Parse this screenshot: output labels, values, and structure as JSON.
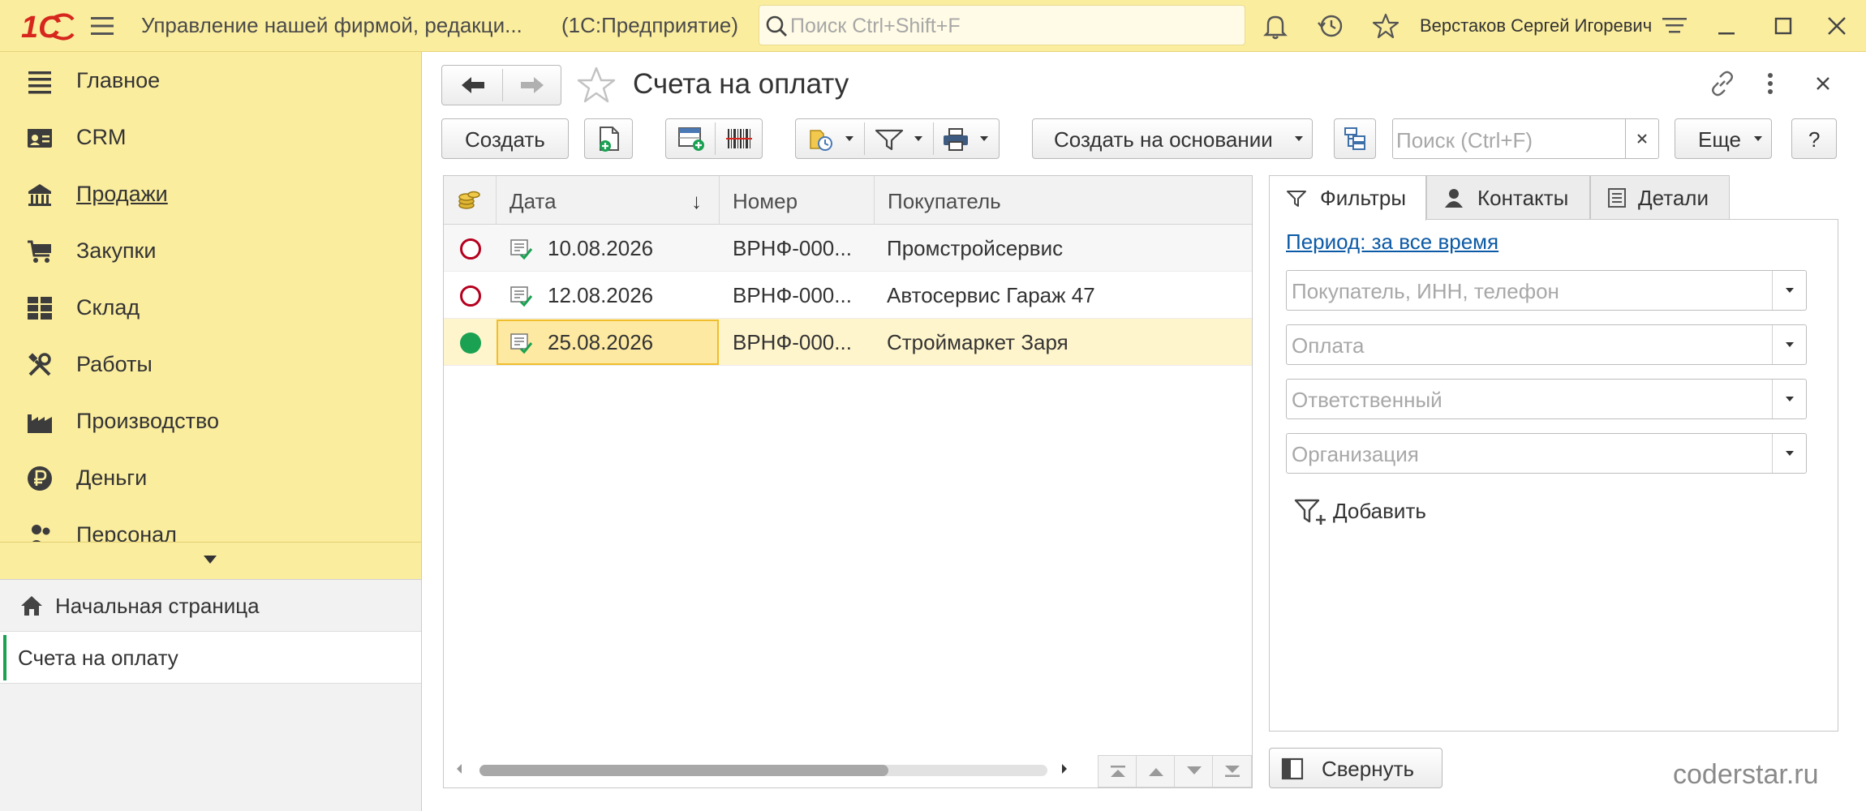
{
  "app": {
    "logo": "1С",
    "title": "Управление нашей фирмой, редакци...",
    "platform": "(1С:Предприятие)",
    "search_placeholder": "Поиск Ctrl+Shift+F",
    "user": "Верстаков Сергей Игоревич"
  },
  "sidebar": {
    "items": [
      {
        "label": "Главное",
        "icon": "list-icon"
      },
      {
        "label": "CRM",
        "icon": "contact-card-icon"
      },
      {
        "label": "Продажи",
        "icon": "shop-icon"
      },
      {
        "label": "Закупки",
        "icon": "cart-icon"
      },
      {
        "label": "Склад",
        "icon": "warehouse-icon"
      },
      {
        "label": "Работы",
        "icon": "tools-icon"
      },
      {
        "label": "Производство",
        "icon": "factory-icon"
      },
      {
        "label": "Деньги",
        "icon": "ruble-icon"
      },
      {
        "label": "Персонал",
        "icon": "people-icon"
      }
    ],
    "open_windows": [
      {
        "label": "Начальная страница"
      },
      {
        "label": "Счета на оплату"
      }
    ]
  },
  "form": {
    "title": "Счета на оплату",
    "create_label": "Создать",
    "create_based_label": "Создать на основании",
    "search_placeholder": "Поиск (Ctrl+F)",
    "more_label": "Еще",
    "help_label": "?"
  },
  "table": {
    "columns": {
      "date": "Дата",
      "number": "Номер",
      "buyer": "Покупатель"
    },
    "sort_indicator": "↓",
    "rows": [
      {
        "status": "unpaid",
        "date": "10.08.2026",
        "number": "ВРНФ-000...",
        "buyer": "Промстройсервис"
      },
      {
        "status": "unpaid",
        "date": "12.08.2026",
        "number": "ВРНФ-000...",
        "buyer": "Автосервис Гараж 47"
      },
      {
        "status": "paid",
        "date": "25.08.2026",
        "number": "ВРНФ-000...",
        "buyer": "Строймаркет Заря"
      }
    ],
    "scroll_position": 0.72
  },
  "panel": {
    "tabs": [
      "Фильтры",
      "Контакты",
      "Детали"
    ],
    "period_link": "Период: за все время",
    "fields": [
      "Покупатель, ИНН, телефон",
      "Оплата",
      "Ответственный",
      "Организация"
    ],
    "add_label": "Добавить",
    "collapse_label": "Свернуть"
  },
  "watermark": "coderstar.ru",
  "colors": {
    "sidebar_bg": "#fbed9e",
    "accent_green": "#1aa152",
    "status_red": "#b5001e",
    "selection": "#fff5cc",
    "link": "#0c5aa6",
    "logo_red": "#d6261d"
  }
}
